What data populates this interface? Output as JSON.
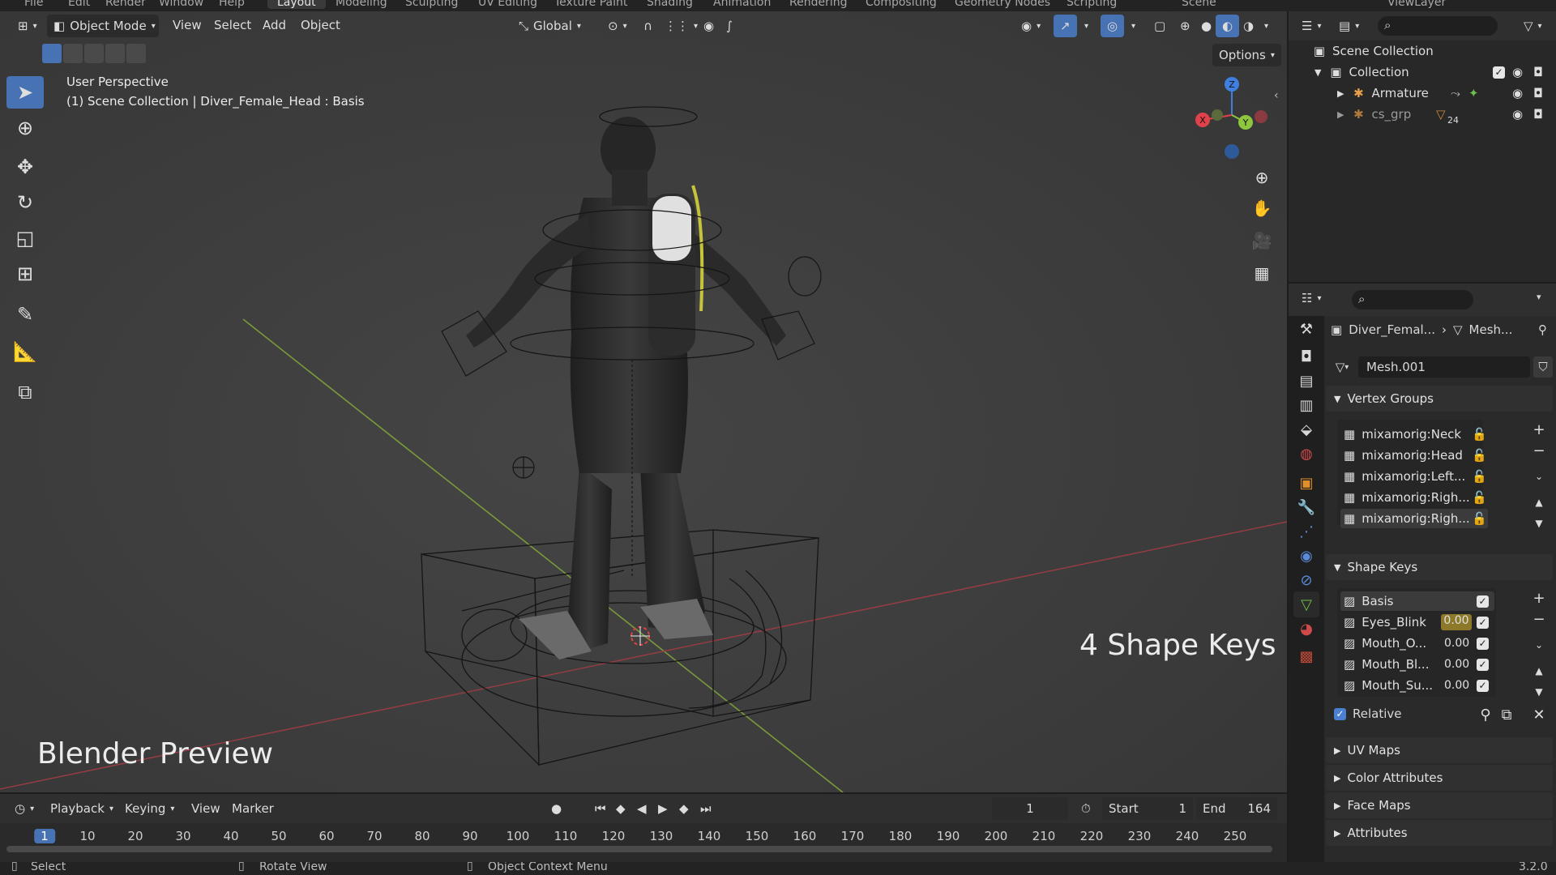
{
  "workspace_tabs": [
    "File",
    "Edit",
    "Render",
    "Window",
    "Help",
    "Layout",
    "Modeling",
    "Sculpting",
    "UV Editing",
    "Texture Paint",
    "Shading",
    "Animation",
    "Rendering",
    "Compositing",
    "Geometry Nodes",
    "Scripting"
  ],
  "scene_name": "Scene",
  "view_layer": "ViewLayer",
  "viewport": {
    "mode": "Object Mode",
    "menus": [
      "View",
      "Select",
      "Add",
      "Object"
    ],
    "orientation": "Global",
    "options_label": "Options",
    "perspective_label": "User Perspective",
    "context_label": "(1) Scene Collection | Diver_Female_Head : Basis",
    "overlay_big_left": "Blender Preview",
    "overlay_big_right": "4 Shape Keys",
    "gizmo": {
      "x": "X",
      "y": "Y",
      "z": "Z"
    }
  },
  "timeline": {
    "menus": [
      "Playback",
      "Keying",
      "View",
      "Marker"
    ],
    "current_frame": "1",
    "start_label": "Start",
    "start_value": "1",
    "end_label": "End",
    "end_value": "164",
    "ticks": [
      "1",
      "10",
      "20",
      "30",
      "40",
      "50",
      "60",
      "70",
      "80",
      "90",
      "100",
      "110",
      "120",
      "130",
      "140",
      "150",
      "160",
      "170",
      "180",
      "190",
      "200",
      "210",
      "220",
      "230",
      "240",
      "250"
    ]
  },
  "statusbar": {
    "select": "Select",
    "rotate": "Rotate View",
    "context": "Object Context Menu",
    "version": "3.2.0"
  },
  "outliner": {
    "root": "Scene Collection",
    "collection": "Collection",
    "items": [
      {
        "name": "Armature"
      },
      {
        "name": "cs_grp",
        "badge": "24"
      }
    ]
  },
  "properties": {
    "breadcrumb_object": "Diver_Femal...",
    "breadcrumb_data": "Mesh...",
    "mesh_name": "Mesh.001",
    "vertex_groups_title": "Vertex Groups",
    "vertex_groups": [
      "mixamorig:Neck",
      "mixamorig:Head",
      "mixamorig:Left...",
      "mixamorig:Righ...",
      "mixamorig:Righ..."
    ],
    "shape_keys_title": "Shape Keys",
    "shape_keys": [
      {
        "name": "Basis",
        "value": ""
      },
      {
        "name": "Eyes_Blink",
        "value": "0.00"
      },
      {
        "name": "Mouth_O...",
        "value": "0.00"
      },
      {
        "name": "Mouth_Bl...",
        "value": "0.00"
      },
      {
        "name": "Mouth_Su...",
        "value": "0.00"
      }
    ],
    "relative_label": "Relative",
    "collapsed_panels": [
      "UV Maps",
      "Color Attributes",
      "Face Maps",
      "Attributes"
    ]
  },
  "colors": {
    "accent": "#4772b3",
    "x_axis": "#e0424b",
    "y_axis": "#8ec63f",
    "z_axis": "#3f7fe0",
    "highlight_value": "#8c7a2a"
  }
}
